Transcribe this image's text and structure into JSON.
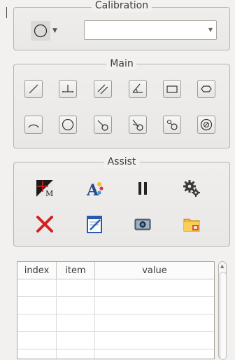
{
  "calibration": {
    "title": "Calibration",
    "shape_icon": "circle-icon",
    "combo_value": ""
  },
  "main": {
    "title": "Main",
    "tools": [
      {
        "name": "line-tool",
        "icon": "line-icon"
      },
      {
        "name": "perpendicular-tool",
        "icon": "perpendicular-icon"
      },
      {
        "name": "parallel-tool",
        "icon": "parallel-lines-icon"
      },
      {
        "name": "angle-tool",
        "icon": "angle-icon"
      },
      {
        "name": "rectangle-tool",
        "icon": "rectangle-icon"
      },
      {
        "name": "hexagon-tool",
        "icon": "hexagon-icon"
      },
      {
        "name": "arc-tool",
        "icon": "arc-icon"
      },
      {
        "name": "circle-tool",
        "icon": "circle-icon"
      },
      {
        "name": "line-to-circle-tool",
        "icon": "line-circle-icon"
      },
      {
        "name": "angle-circle-tool",
        "icon": "angle-circle-icon"
      },
      {
        "name": "circle-to-circle-tool",
        "icon": "two-circles-icon"
      },
      {
        "name": "concentric-circle-tool",
        "icon": "concentric-circles-icon"
      }
    ]
  },
  "assist": {
    "title": "Assist",
    "tools": [
      {
        "name": "marker-tool",
        "icon": "marker-m-icon"
      },
      {
        "name": "text-format-tool",
        "icon": "text-style-icon"
      },
      {
        "name": "pause-tool",
        "icon": "pause-icon"
      },
      {
        "name": "settings-tool",
        "icon": "gears-icon"
      },
      {
        "name": "delete-tool",
        "icon": "red-x-icon"
      },
      {
        "name": "edit-tool",
        "icon": "notepad-edit-icon"
      },
      {
        "name": "snapshot-tool",
        "icon": "camera-icon"
      },
      {
        "name": "open-folder-tool",
        "icon": "folder-icon"
      }
    ]
  },
  "table": {
    "headers": {
      "index": "index",
      "item": "item",
      "value": "value"
    },
    "rows": [
      {
        "index": "",
        "item": "",
        "value": ""
      },
      {
        "index": "",
        "item": "",
        "value": ""
      },
      {
        "index": "",
        "item": "",
        "value": ""
      },
      {
        "index": "",
        "item": "",
        "value": ""
      },
      {
        "index": "",
        "item": "",
        "value": ""
      }
    ]
  }
}
